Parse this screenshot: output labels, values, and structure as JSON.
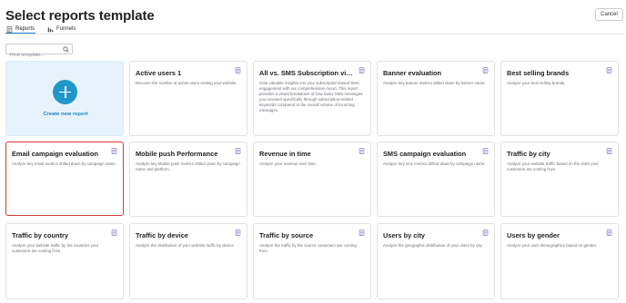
{
  "header": {
    "title": "Select reports template",
    "cancel_label": "Cancel"
  },
  "tabs": [
    {
      "label": "Reports",
      "icon": "reports-icon",
      "active": true
    },
    {
      "label": "Funnels",
      "icon": "funnels-icon",
      "active": false
    }
  ],
  "search": {
    "placeholder": "Find template...",
    "value": ""
  },
  "create_new": {
    "label": "Create new report"
  },
  "cards": [
    {
      "title": "Active users 1",
      "desc": "Discover the number of active users visiting your website.",
      "selected": false
    },
    {
      "title": "All vs. SMS Subscription via T...",
      "desc": "Gain valuable insights into your subscription-based SMS engagement with our comprehensive report. This report provides a visual breakdown of how many SMS messages you received specifically through subscription-related keywords compared to the overall volume of incoming messages.",
      "selected": false
    },
    {
      "title": "Banner evaluation",
      "desc": "Analyze key banner metrics drilled down by banner name.",
      "selected": false
    },
    {
      "title": "Best selling brands",
      "desc": "Analyze your best selling brands.",
      "selected": false
    },
    {
      "title": "Email campaign evaluation",
      "desc": "Analyze key email metrics drilled down by campaign name.",
      "selected": true
    },
    {
      "title": "Mobile push Performance",
      "desc": "Analyze key Mobile push metrics drilled down by campaign name and platform.",
      "selected": false
    },
    {
      "title": "Revenue in time",
      "desc": "Analyze your revenue over time.",
      "selected": false
    },
    {
      "title": "SMS campaign evaluation",
      "desc": "Analyze key sms metrics drilled down by campaign name.",
      "selected": false
    },
    {
      "title": "Traffic by city",
      "desc": "Analyze your website traffic based on the cities your customers are coming from.",
      "selected": false
    },
    {
      "title": "Traffic by country",
      "desc": "Analyze your website traffic by the countries your customers are coming from.",
      "selected": false
    },
    {
      "title": "Traffic by device",
      "desc": "Analyze the distribution of your website traffic by device.",
      "selected": false
    },
    {
      "title": "Traffic by source",
      "desc": "Analyze the traffic by the source customers are coming from.",
      "selected": false
    },
    {
      "title": "Users by city",
      "desc": "Analyze the geographic distribution of your users by city.",
      "selected": false
    },
    {
      "title": "Users by gender",
      "desc": "Analyze your user demographics based on gender.",
      "selected": false
    }
  ],
  "colors": {
    "accent": "#2196c9",
    "selected_border": "#d93a3a",
    "new_card_bg": "#e6f3fb"
  }
}
